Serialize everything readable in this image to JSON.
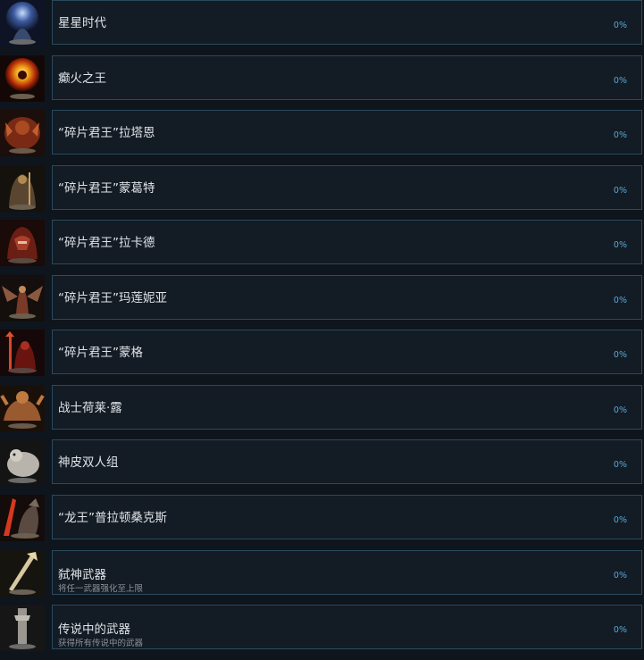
{
  "achievements": [
    {
      "title": "星星时代",
      "description": "",
      "percent": "0%",
      "icon": "astrologer-icon"
    },
    {
      "title": "癫火之王",
      "description": "",
      "percent": "0%",
      "icon": "frenzied-flame-icon"
    },
    {
      "title": "“碎片君王”拉塔恩",
      "description": "",
      "percent": "0%",
      "icon": "radahn-icon"
    },
    {
      "title": "“碎片君王”蒙葛特",
      "description": "",
      "percent": "0%",
      "icon": "morgott-icon"
    },
    {
      "title": "“碎片君王”拉卡德",
      "description": "",
      "percent": "0%",
      "icon": "rykard-icon"
    },
    {
      "title": "“碎片君王”玛莲妮亚",
      "description": "",
      "percent": "0%",
      "icon": "malenia-icon"
    },
    {
      "title": "“碎片君王”蒙格",
      "description": "",
      "percent": "0%",
      "icon": "mohg-icon"
    },
    {
      "title": "战士荷莱·露",
      "description": "",
      "percent": "0%",
      "icon": "hoarah-loux-icon"
    },
    {
      "title": "神皮双人组",
      "description": "",
      "percent": "0%",
      "icon": "godskin-duo-icon"
    },
    {
      "title": "“龙王”普拉顿桑克斯",
      "description": "",
      "percent": "0%",
      "icon": "dragonlord-icon"
    },
    {
      "title": "弑神武器",
      "description": "将任一武器强化至上限",
      "percent": "0%",
      "icon": "upgraded-weapon-icon"
    },
    {
      "title": "传说中的武器",
      "description": "获得所有传说中的武器",
      "percent": "0%",
      "icon": "legendary-armament-icon"
    }
  ]
}
